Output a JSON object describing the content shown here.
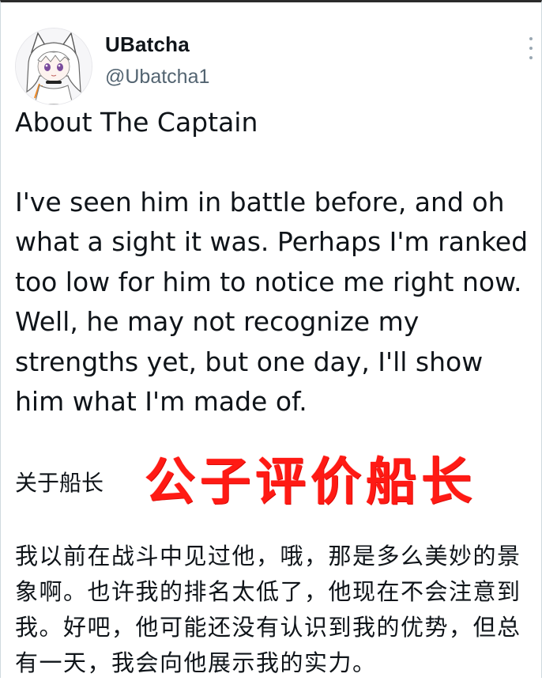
{
  "author": {
    "display_name": "UBatcha",
    "handle": "@Ubatcha1",
    "avatar_icon": "anime-catgirl-avatar-icon"
  },
  "menu": {
    "more_icon": "more-vertical-icon"
  },
  "tweet": {
    "title_en": "About The Captain",
    "body_en": "I've seen him in battle before, and oh what a sight it was. Perhaps I'm ranked too low for him to notice me right now. Well, he may not recognize my strengths yet, but one day, I'll show him what I'm made of.",
    "title_zh": "关于船长",
    "body_zh": "我以前在战斗中见过他，哦，那是多么美妙的景象啊。也许我的排名太低了，他现在不会注意到我。好吧，他可能还没有认识到我的优势，但总有一天，我会向他展示我的实力。"
  },
  "overlay": {
    "banner_text": "公子评价船长",
    "color": "#ff1a14"
  },
  "colors": {
    "text": "#0f1419",
    "secondary": "#536471",
    "border": "#cfd9de"
  }
}
